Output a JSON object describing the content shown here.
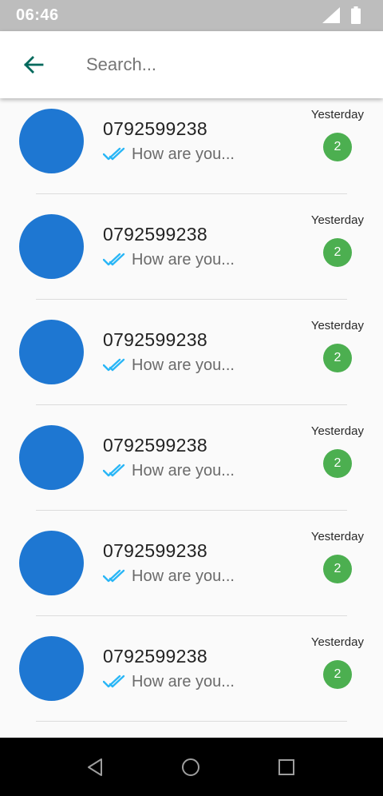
{
  "status_bar": {
    "time": "06:46"
  },
  "search": {
    "placeholder": "Search..."
  },
  "chats": [
    {
      "name": "0792599238",
      "preview": "How are you...",
      "time": "Yesterday",
      "unread": "2"
    },
    {
      "name": "0792599238",
      "preview": "How are you...",
      "time": "Yesterday",
      "unread": "2"
    },
    {
      "name": "0792599238",
      "preview": "How are you...",
      "time": "Yesterday",
      "unread": "2"
    },
    {
      "name": "0792599238",
      "preview": "How are you...",
      "time": "Yesterday",
      "unread": "2"
    },
    {
      "name": "0792599238",
      "preview": "How are you...",
      "time": "Yesterday",
      "unread": "2"
    },
    {
      "name": "0792599238",
      "preview": "How are you...",
      "time": "Yesterday",
      "unread": "2"
    }
  ],
  "colors": {
    "accent": "#00695c",
    "avatar": "#1e77d2",
    "badge": "#4caf50",
    "read_check": "#29b6f6"
  },
  "icons": {
    "back": "arrow-back-icon",
    "read_receipt": "double-check-icon",
    "signal": "signal-icon",
    "battery": "battery-icon"
  }
}
